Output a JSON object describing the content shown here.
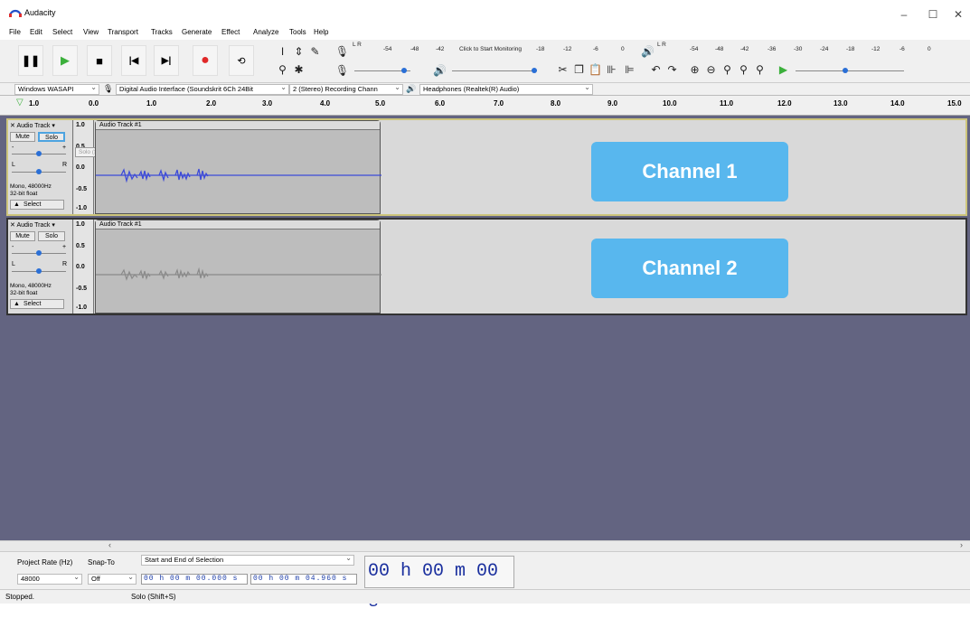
{
  "app": {
    "title": "Audacity"
  },
  "menu": [
    "File",
    "Edit",
    "Select",
    "View",
    "Transport",
    "Tracks",
    "Generate",
    "Effect",
    "Analyze",
    "Tools",
    "Help"
  ],
  "meters": {
    "record_scale": [
      "-54",
      "-48",
      "-42",
      "Click to Start Monitoring",
      "-18",
      "-12",
      "-6",
      "0"
    ],
    "play_scale": [
      "-54",
      "-48",
      "-42",
      "-36",
      "-30",
      "-24",
      "-18",
      "-12",
      "-6",
      "0"
    ],
    "record_lr": "L R",
    "play_lr": "L R"
  },
  "devices": {
    "host": "Windows WASAPI",
    "input": "Digital Audio Interface (Soundskrit 6Ch 24Bit",
    "channels": "2 (Stereo) Recording Chann",
    "output": "Headphones (Realtek(R) Audio)"
  },
  "ruler": {
    "ticks": [
      "1.0",
      "0.0",
      "1.0",
      "2.0",
      "3.0",
      "4.0",
      "5.0",
      "6.0",
      "7.0",
      "8.0",
      "9.0",
      "10.0",
      "11.0",
      "12.0",
      "13.0",
      "14.0",
      "15.0"
    ]
  },
  "tracks": [
    {
      "name": "Audio Track",
      "clip_name": "Audio Track #1",
      "mute": "Mute",
      "solo": "Solo",
      "gain_minus": "-",
      "gain_plus": "+",
      "pan_l": "L",
      "pan_r": "R",
      "info": "Mono, 48000Hz",
      "format": "32-bit float",
      "select": "Select",
      "scale": [
        "1.0",
        "0.5",
        "0.0",
        "-0.5",
        "-1.0"
      ],
      "tooltip": "Solo (Shift+S)",
      "callout": "Channel 1"
    },
    {
      "name": "Audio Track",
      "clip_name": "Audio Track #1",
      "mute": "Mute",
      "solo": "Solo",
      "gain_minus": "-",
      "gain_plus": "+",
      "pan_l": "L",
      "pan_r": "R",
      "info": "Mono, 48000Hz",
      "format": "32-bit float",
      "select": "Select",
      "scale": [
        "1.0",
        "0.5",
        "0.0",
        "-0.5",
        "-1.0"
      ],
      "callout": "Channel 2"
    }
  ],
  "selection": {
    "project_rate_label": "Project Rate (Hz)",
    "snap_label": "Snap-To",
    "mode": "Start and End of Selection",
    "rate": "48000",
    "snap": "Off",
    "start": "00 h 00 m 00.000 s",
    "end": "00 h 00 m 04.960 s",
    "position": "00 h 00 m 00 s"
  },
  "status": {
    "left": "Stopped.",
    "right": "Solo (Shift+S)"
  },
  "colors": {
    "track_bg": "#636481",
    "callout": "#58b7ee",
    "waveform_active": "#3d4bd8",
    "waveform_muted": "#8a8a8a",
    "selected_border": "#cdc57b"
  }
}
